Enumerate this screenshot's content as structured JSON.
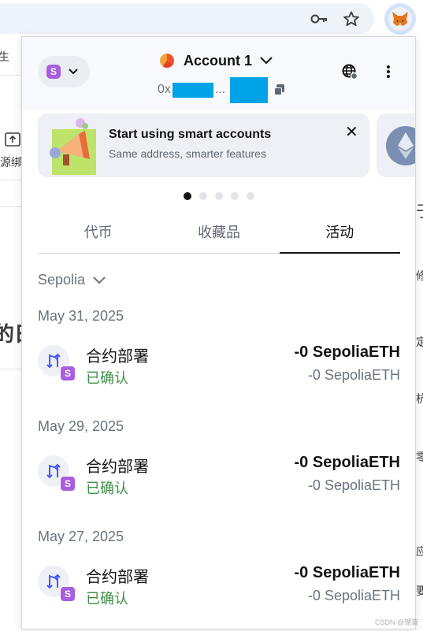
{
  "background_page": {
    "left_fragments": [
      "生",
      "源绑",
      "的日"
    ],
    "right_fragments": [
      "于",
      "修",
      "定",
      "杭",
      "零",
      "应",
      "要"
    ]
  },
  "popup": {
    "network": {
      "badge": "S"
    },
    "account": {
      "name": "Account 1",
      "address_prefix": "0x",
      "address_ellipsis": "..."
    },
    "banner": {
      "title": "Start using smart accounts",
      "subtitle": "Same address, smarter features",
      "close": "✕"
    },
    "tabs": [
      {
        "label": "代币",
        "active": false
      },
      {
        "label": "收藏品",
        "active": false
      },
      {
        "label": "活动",
        "active": true
      }
    ],
    "network_filter": {
      "label": "Sepolia"
    },
    "activity": [
      {
        "date": "May 31, 2025",
        "title": "合约部署",
        "status": "已确认",
        "amount": "-0 SepoliaETH",
        "fiat": "-0 SepoliaETH",
        "badge": "S"
      },
      {
        "date": "May 29, 2025",
        "title": "合约部署",
        "status": "已确认",
        "amount": "-0 SepoliaETH",
        "fiat": "-0 SepoliaETH",
        "badge": "S"
      },
      {
        "date": "May 27, 2025",
        "title": "合约部署",
        "status": "已确认",
        "amount": "-0 SepoliaETH",
        "fiat": "-0 SepoliaETH",
        "badge": "S"
      }
    ]
  },
  "watermark": "CSDN @锶奋",
  "colors": {
    "network_badge": "#a95ddf",
    "status_confirmed": "#3e8f47",
    "address_redaction": "#00a2e8"
  },
  "icons": [
    "key-icon",
    "star-icon",
    "metamask-fox-icon",
    "globe-icon",
    "more-vertical-icon",
    "copy-icon",
    "close-icon",
    "chevron-down-icon",
    "contract-deploy-icon"
  ]
}
